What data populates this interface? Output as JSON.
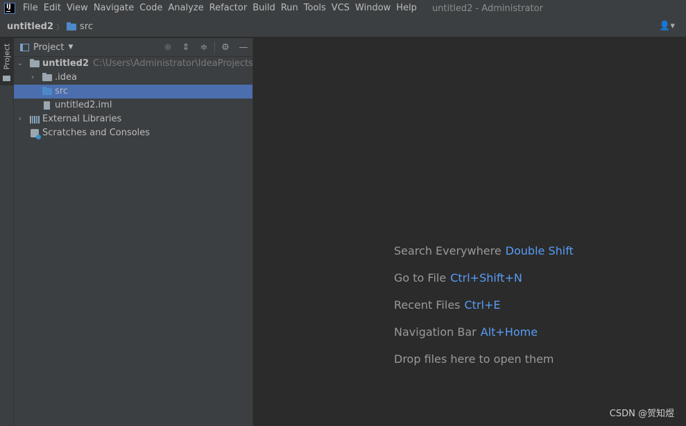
{
  "menu": [
    "File",
    "Edit",
    "View",
    "Navigate",
    "Code",
    "Analyze",
    "Refactor",
    "Build",
    "Run",
    "Tools",
    "VCS",
    "Window",
    "Help"
  ],
  "window_title": "untitled2 - Administrator",
  "breadcrumb": {
    "project": "untitled2",
    "folder": "src"
  },
  "sidebar": {
    "tab_label": "Project"
  },
  "panel": {
    "title": "Project"
  },
  "tree": {
    "root": {
      "name": "untitled2",
      "path": "C:\\Users\\Administrator\\IdeaProjects\\untitl"
    },
    "idea": ".idea",
    "src": "src",
    "iml": "untitled2.iml",
    "ext_libs": "External Libraries",
    "scratches": "Scratches and Consoles"
  },
  "hints": [
    {
      "label": "Search Everywhere",
      "key": "Double Shift"
    },
    {
      "label": "Go to File",
      "key": "Ctrl+Shift+N"
    },
    {
      "label": "Recent Files",
      "key": "Ctrl+E"
    },
    {
      "label": "Navigation Bar",
      "key": "Alt+Home"
    },
    {
      "label": "Drop files here to open them",
      "key": ""
    }
  ],
  "watermark": "CSDN @贺知煜",
  "colors": {
    "selection": "#4b6eaf",
    "shortcut": "#589df6",
    "folder": "#4d89c9"
  }
}
